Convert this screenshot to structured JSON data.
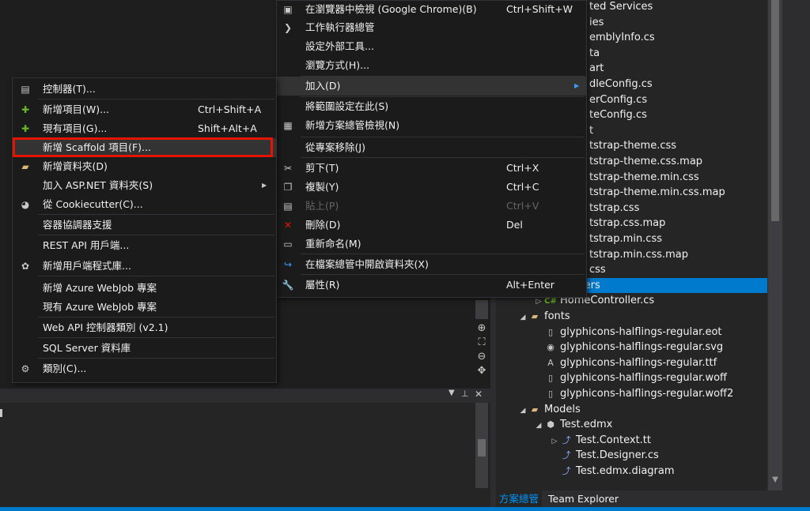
{
  "colors": {
    "accent": "#007acc",
    "highlight_border": "#e51400",
    "menu_bg": "#1b1b1c",
    "folder": "#dcb67a"
  },
  "context_menu_main": {
    "items": [
      {
        "label": "在瀏覽器中檢視 (Google Chrome)(B)",
        "shortcut": "Ctrl+Shift+W",
        "icon": "browser-view-icon"
      },
      {
        "label": "工作執行器總管",
        "shortcut": "",
        "icon": "chevron-right-icon"
      },
      {
        "label": "設定外部工具...",
        "shortcut": "",
        "icon": ""
      },
      {
        "label": "瀏覽方式(H)...",
        "shortcut": "",
        "icon": ""
      },
      {
        "label": "加入(D)",
        "shortcut": "",
        "icon": "",
        "submenu": true
      },
      {
        "label": "將範圍設定在此(S)",
        "shortcut": "",
        "icon": ""
      },
      {
        "label": "新增方案總管檢視(N)",
        "shortcut": "",
        "icon": "solution-view-icon"
      },
      {
        "label": "從專案移除(J)",
        "shortcut": "",
        "icon": ""
      },
      {
        "label": "剪下(T)",
        "shortcut": "Ctrl+X",
        "icon": "cut-icon"
      },
      {
        "label": "複製(Y)",
        "shortcut": "Ctrl+C",
        "icon": "copy-icon"
      },
      {
        "label": "貼上(P)",
        "shortcut": "Ctrl+V",
        "icon": "paste-icon",
        "disabled": true
      },
      {
        "label": "刪除(D)",
        "shortcut": "Del",
        "icon": "delete-icon"
      },
      {
        "label": "重新命名(M)",
        "shortcut": "",
        "icon": "rename-icon"
      },
      {
        "label": "在檔案總管中開啟資料夾(X)",
        "shortcut": "",
        "icon": "open-folder-icon"
      },
      {
        "label": "屬性(R)",
        "shortcut": "Alt+Enter",
        "icon": "properties-icon"
      }
    ]
  },
  "context_menu_add": {
    "items": [
      {
        "label": "控制器(T)...",
        "shortcut": "",
        "icon": "controller-icon"
      },
      {
        "label": "新增項目(W)...",
        "shortcut": "Ctrl+Shift+A",
        "icon": "new-item-icon"
      },
      {
        "label": "現有項目(G)...",
        "shortcut": "Shift+Alt+A",
        "icon": "existing-item-icon"
      },
      {
        "label": "新增 Scaffold 項目(F)...",
        "shortcut": "",
        "icon": ""
      },
      {
        "label": "新增資料夾(D)",
        "shortcut": "",
        "icon": "new-folder-icon"
      },
      {
        "label": "加入 ASP.NET 資料夾(S)",
        "shortcut": "",
        "icon": "",
        "submenu": true
      },
      {
        "label": "從 Cookiecutter(C)...",
        "shortcut": "",
        "icon": "cookiecutter-icon"
      },
      {
        "label": "容器協調器支援",
        "shortcut": "",
        "icon": ""
      },
      {
        "label": "REST API 用戶端...",
        "shortcut": "",
        "icon": ""
      },
      {
        "label": "新增用戶端程式庫...",
        "shortcut": "",
        "icon": "client-library-icon"
      },
      {
        "label": "新增 Azure WebJob 專案",
        "shortcut": "",
        "icon": ""
      },
      {
        "label": "現有 Azure WebJob 專案",
        "shortcut": "",
        "icon": ""
      },
      {
        "label": "Web API 控制器類別 (v2.1)",
        "shortcut": "",
        "icon": ""
      },
      {
        "label": "SQL Server 資料庫",
        "shortcut": "",
        "icon": ""
      },
      {
        "label": "類別(C)...",
        "shortcut": "",
        "icon": "class-icon"
      }
    ]
  },
  "solution_explorer": {
    "rows": [
      {
        "text": "ted Services",
        "indent": 0
      },
      {
        "text": "ies",
        "indent": 0
      },
      {
        "text": "emblyInfo.cs",
        "indent": 0
      },
      {
        "text": "ta",
        "indent": 0
      },
      {
        "text": "art",
        "indent": 0
      },
      {
        "text": "dleConfig.cs",
        "indent": 0
      },
      {
        "text": "erConfig.cs",
        "indent": 0
      },
      {
        "text": "teConfig.cs",
        "indent": 0
      },
      {
        "text": "t",
        "indent": 0
      },
      {
        "text": "tstrap-theme.css",
        "indent": 0
      },
      {
        "text": "tstrap-theme.css.map",
        "indent": 0
      },
      {
        "text": "tstrap-theme.min.css",
        "indent": 0
      },
      {
        "text": "tstrap-theme.min.css.map",
        "indent": 0
      },
      {
        "text": "tstrap.css",
        "indent": 0
      },
      {
        "text": "tstrap.css.map",
        "indent": 0
      },
      {
        "text": "tstrap.min.css",
        "indent": 0
      },
      {
        "text": "tstrap.min.css.map",
        "indent": 0
      },
      {
        "text": "css",
        "indent": 0
      },
      {
        "text": "Controllers",
        "indent": 1,
        "tw": "◢",
        "icon": "folder-icon",
        "selected": true
      },
      {
        "text": "HomeController.cs",
        "indent": 2,
        "tw": "▷",
        "icon": "csharp-icon"
      },
      {
        "text": "fonts",
        "indent": 1,
        "tw": "◢",
        "icon": "folder-icon"
      },
      {
        "text": "glyphicons-halflings-regular.eot",
        "indent": 2,
        "icon": "file-icon"
      },
      {
        "text": "glyphicons-halflings-regular.svg",
        "indent": 2,
        "icon": "svg-file-icon"
      },
      {
        "text": "glyphicons-halflings-regular.ttf",
        "indent": 2,
        "icon": "font-file-icon"
      },
      {
        "text": "glyphicons-halflings-regular.woff",
        "indent": 2,
        "icon": "file-icon"
      },
      {
        "text": "glyphicons-halflings-regular.woff2",
        "indent": 2,
        "icon": "file-icon"
      },
      {
        "text": "Models",
        "indent": 1,
        "tw": "◢",
        "icon": "folder-icon"
      },
      {
        "text": "Test.edmx",
        "indent": 2,
        "tw": "◢",
        "icon": "edmx-icon"
      },
      {
        "text": "Test.Context.tt",
        "indent": 3,
        "tw": "▷",
        "icon": "tt-file-icon"
      },
      {
        "text": "Test.Designer.cs",
        "indent": 3,
        "icon": "tt-file-icon"
      },
      {
        "text": "Test.edmx.diagram",
        "indent": 3,
        "icon": "tt-file-icon"
      }
    ],
    "tabs": [
      "方案總管",
      "Team Explorer"
    ]
  }
}
